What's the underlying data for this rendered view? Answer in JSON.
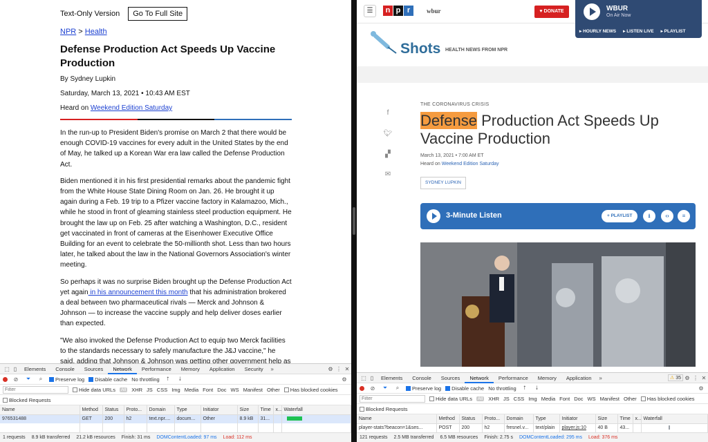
{
  "left": {
    "version_label": "Text-Only Version",
    "full_site_button": "Go To Full Site",
    "breadcrumb": {
      "home": "NPR",
      "separator": ">",
      "section": "Health"
    },
    "title": "Defense Production Act Speeds Up Vaccine Production",
    "byline": "By Sydney Lupkin",
    "dateline": "Saturday, March 13, 2021 • 10:43 AM EST",
    "heard_prefix": "Heard on ",
    "heard_link": "Weekend Edition Saturday",
    "paragraphs": [
      "In the run-up to President Biden's promise on March 2 that there would be enough COVID-19 vaccines for every adult in the United States by the end of May, he talked up a Korean War era law called the Defense Production Act.",
      "Biden mentioned it in his first presidential remarks about the pandemic fight from the White House State Dining Room on Jan. 26. He brought it up again during a Feb. 19 trip to a Pfizer vaccine factory in Kalamazoo, Mich., while he stood in front of gleaming stainless steel production equipment. He brought the law up on Feb. 25 after watching a Washington, D.C., resident get vaccinated in front of cameras at the Eisenhower Executive Office Building for an event to celebrate the 50-millionth shot. Less than two hours later, he talked about the law in the National Governors Association's winter meeting."
    ],
    "p3_before": "So perhaps it was no surprise Biden brought up the Defense Production Act yet again",
    "p3_link": " in his announcement this month",
    "p3_after": " that his administration brokered a deal between two pharmaceutical rivals — Merck and Johnson & Johnson — to increase the vaccine supply and help deliver doses earlier than expected.",
    "p4": "\"We also invoked the Defense Production Act to equip two Merck facilities to the standards necessary to safely manufacture the J&J vaccine,\" he said, adding that Johnson & Johnson was getting other government help as well. \"In addition, we'll continue to use the Defense Production Act to expedite critical materials, equipment and machinery that is needed to speed up the vaccine",
    "devtools": {
      "tabs": [
        "Elements",
        "Console",
        "Sources",
        "Network",
        "Performance",
        "Memory",
        "Application",
        "Security"
      ],
      "preserve_log": "Preserve log",
      "disable_cache": "Disable cache",
      "throttling": "No throttling",
      "filter_placeholder": "Filter",
      "hide_data_urls": "Hide data URLs",
      "all": "All",
      "types": [
        "XHR",
        "JS",
        "CSS",
        "Img",
        "Media",
        "Font",
        "Doc",
        "WS",
        "Manifest",
        "Other"
      ],
      "has_blocked": "Has blocked cookies",
      "blocked_requests": "Blocked Requests",
      "columns": [
        "Name",
        "Method",
        "Status",
        "Proto...",
        "Domain",
        "Type",
        "Initiator",
        "Size",
        "Time",
        "x...",
        "Waterfall"
      ],
      "rows": [
        [
          "976531488",
          "GET",
          "200",
          "h2",
          "text.npr....",
          "docum...",
          "Other",
          "8.9 kB",
          "31...",
          ""
        ]
      ],
      "status": {
        "requests": "1 requests",
        "transferred": "8.9 kB transferred",
        "resources": "21.2 kB resources",
        "finish": "Finish: 31 ms",
        "dcl": "DOMContentLoaded: 97 ms",
        "load": "Load: 112 ms"
      }
    }
  },
  "right": {
    "nav": {
      "npr_letters": [
        "n",
        "p",
        "r"
      ],
      "wbur": "wbur",
      "donate": "DONATE",
      "station": "WBUR",
      "on_air": "On Air Now",
      "links": [
        "HOURLY NEWS",
        "LISTEN LIVE",
        "PLAYLIST"
      ]
    },
    "shots": "Shots",
    "shots_tag": "HEALTH NEWS FROM NPR",
    "kicker": "THE CORONAVIRUS CRISIS",
    "title_highlight": "Defense",
    "title_rest": " Production Act Speeds Up Vaccine Production",
    "date": "March 13, 2021 • 7:00 AM ET",
    "heard_prefix": "Heard on ",
    "heard_link": "Weekend Edition Saturday",
    "author": "SYDNEY LUPKIN",
    "listen_label": "3-Minute Listen",
    "playlist_label": "+ PLAYLIST",
    "devtools": {
      "tabs": [
        "Elements",
        "Console",
        "Sources",
        "Network",
        "Performance",
        "Memory",
        "Application"
      ],
      "warnings": "35",
      "preserve_log": "Preserve log",
      "disable_cache": "Disable cache",
      "throttling": "No throttling",
      "filter_placeholder": "Filter",
      "hide_data_urls": "Hide data URLs",
      "all": "All",
      "types": [
        "XHR",
        "JS",
        "CSS",
        "Img",
        "Media",
        "Font",
        "Doc",
        "WS",
        "Manifest",
        "Other"
      ],
      "has_blocked": "Has blocked cookies",
      "blocked_requests": "Blocked Requests",
      "columns": [
        "Name",
        "Method",
        "Status",
        "Proto...",
        "Domain",
        "Type",
        "Initiator",
        "Size",
        "Time",
        "x...",
        "Waterfall"
      ],
      "rows": [
        [
          "player-stats?beacon=1&ses...",
          "POST",
          "200",
          "h2",
          "fresnel.v...",
          "text/plain",
          "player.js:10",
          "40 B",
          "43...",
          ""
        ]
      ],
      "status": {
        "requests": "121 requests",
        "transferred": "2.5 MB transferred",
        "resources": "6.5 MB resources",
        "finish": "Finish: 2.75 s",
        "dcl": "DOMContentLoaded: 295 ms",
        "load": "Load: 376 ms"
      }
    }
  },
  "colors": {
    "link": "#1a3fd1",
    "npr_red": "#d62021",
    "npr_black": "#111111",
    "npr_blue": "#2f6fb9",
    "onair_bg": "#2f4a73",
    "highlight": "#f59b3f",
    "devtools_accent": "#1a73e8"
  }
}
